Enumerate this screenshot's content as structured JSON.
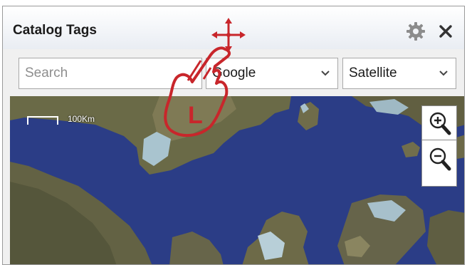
{
  "header": {
    "title": "Catalog Tags"
  },
  "toolbar": {
    "search_placeholder": "Search",
    "provider": {
      "selected": "Google"
    },
    "map_type": {
      "selected": "Satellite"
    }
  },
  "map": {
    "scale_label": "100Km"
  },
  "overlay": {
    "gesture_letter": "L"
  },
  "icons": {
    "settings": "gear-icon",
    "close": "close-icon",
    "zoom_in": "zoom-in-icon",
    "zoom_out": "zoom-out-icon",
    "move": "move-icon",
    "hand": "hand-pointer-icon"
  },
  "colors": {
    "water": "#2b3d86",
    "gesture": "#c8262b",
    "panel_border": "#9a9a9a"
  }
}
